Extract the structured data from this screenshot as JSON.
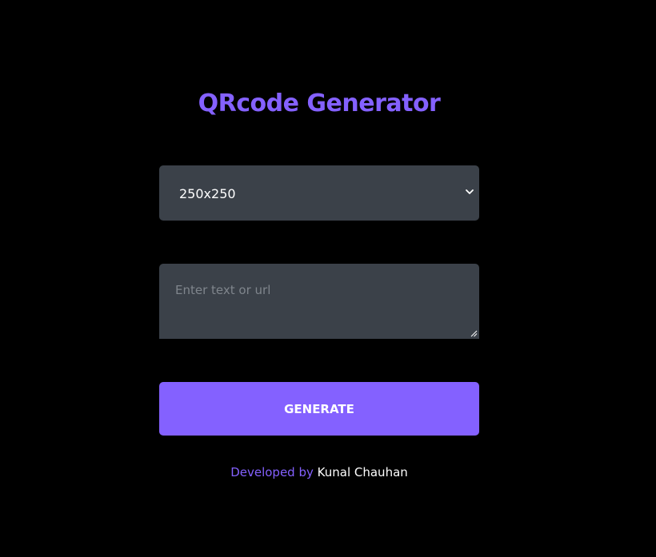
{
  "header": {
    "title": "QRcode Generator"
  },
  "size_select": {
    "selected": "250x250",
    "icon": "chevron-down-icon"
  },
  "text_input": {
    "value": "",
    "placeholder": "Enter text or url",
    "icon": "resize-handle-icon"
  },
  "generate_button": {
    "label": "GENERATE"
  },
  "footer": {
    "prefix": "Developed by",
    "author": "Kunal Chauhan"
  },
  "colors": {
    "background": "#000000",
    "accent": "#8461ff",
    "field_background": "#3b4149",
    "text_primary": "#ffffff",
    "placeholder": "#7f858c"
  }
}
